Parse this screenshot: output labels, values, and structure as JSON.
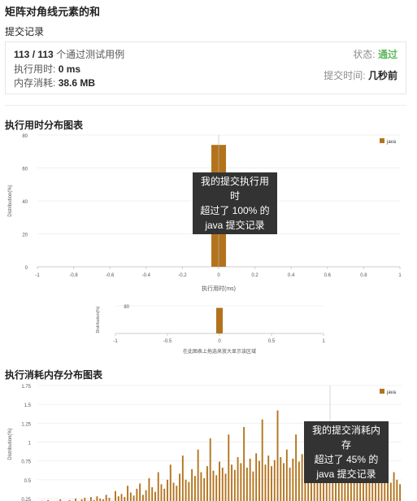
{
  "page": {
    "title": "矩阵对角线元素的和",
    "subtitle": "提交记录"
  },
  "summary": {
    "passed": "113 / 113",
    "passed_suffix": "个通过测试用例",
    "runtime_label": "执行用时:",
    "runtime_value": "0 ms",
    "memory_label": "内存消耗:",
    "memory_value": "38.6 MB",
    "status_label": "状态:",
    "status_value": "通过",
    "submit_time_label": "提交时间:",
    "submit_time_value": "几秒前"
  },
  "colors": {
    "accent_ok": "#5cb85c",
    "bar": "#b3731d",
    "tooltip_bg": "#333333"
  },
  "runtime_section": {
    "title": "执行用时分布图表",
    "tooltip": [
      "我的提交执行用时",
      "超过了 100% 的",
      "java 提交记录"
    ],
    "brush_hint": "在此图表上拖选来放大显示该区域"
  },
  "memory_section": {
    "title": "执行消耗内存分布图表",
    "tooltip": [
      "我的提交消耗内存",
      "超过了 45% 的",
      "java 提交记录"
    ]
  },
  "chart_data": [
    {
      "type": "bar",
      "title": "执行用时分布图表",
      "xlabel": "执行用时(ms)",
      "ylabel": "Distribution(%)",
      "xlim": [
        -1,
        1
      ],
      "ylim": [
        0,
        80
      ],
      "x_ticks": [
        "-1",
        "-0.8",
        "-0.6",
        "-0.4",
        "-0.2",
        "0",
        "0.2",
        "0.4",
        "0.6",
        "0.8",
        "1"
      ],
      "y_ticks": [
        "0",
        "20",
        "40",
        "60",
        "80"
      ],
      "legend": "java",
      "legend_position": "top-right",
      "series": [
        {
          "name": "java",
          "x": [
            0
          ],
          "values": [
            74
          ]
        }
      ]
    },
    {
      "type": "bar",
      "title": "",
      "xlabel": "在此图表上拖选来放大显示该区域",
      "ylabel": "Distribution(%)",
      "xlim": [
        -1,
        1
      ],
      "ylim": [
        0,
        80
      ],
      "x_ticks": [
        "-1",
        "-0.5",
        "0",
        "0.5",
        "1"
      ],
      "y_ticks": [
        "80"
      ],
      "series": [
        {
          "name": "java",
          "x": [
            0
          ],
          "values": [
            74
          ]
        }
      ]
    },
    {
      "type": "bar",
      "title": "执行消耗内存分布图表",
      "ylabel": "Distribution(%)",
      "ylim": [
        0,
        1.75
      ],
      "y_ticks": [
        "0.25",
        "0.5",
        "0.75",
        "1",
        "1.25",
        "1.5",
        "1.75"
      ],
      "legend": "java",
      "legend_position": "top-right",
      "series": [
        {
          "name": "java",
          "values": [
            0.21,
            0.22,
            0.2,
            0.23,
            0.21,
            0.19,
            0.22,
            0.24,
            0.2,
            0.21,
            0.23,
            0.22,
            0.25,
            0.21,
            0.24,
            0.26,
            0.22,
            0.27,
            0.23,
            0.28,
            0.25,
            0.24,
            0.3,
            0.26,
            0.22,
            0.35,
            0.28,
            0.31,
            0.27,
            0.42,
            0.33,
            0.29,
            0.38,
            0.45,
            0.3,
            0.36,
            0.52,
            0.4,
            0.34,
            0.6,
            0.44,
            0.38,
            0.5,
            0.7,
            0.46,
            0.42,
            0.58,
            0.82,
            0.5,
            0.47,
            0.64,
            0.55,
            0.9,
            0.6,
            0.52,
            0.68,
            1.05,
            0.62,
            0.56,
            0.74,
            0.66,
            0.58,
            1.1,
            0.7,
            0.63,
            0.8,
            0.72,
            1.2,
            0.66,
            0.78,
            0.61,
            0.85,
            0.75,
            1.3,
            0.7,
            0.82,
            0.68,
            0.76,
            1.42,
            0.8,
            0.72,
            0.9,
            0.66,
            0.78,
            1.1,
            0.74,
            0.84,
            0.7,
            0.95,
            0.62,
            0.8,
            1.15,
            0.72,
            0.86,
            0.68,
            0.76,
            0.6,
            0.7,
            1.0,
            0.66,
            0.74,
            0.58,
            0.65,
            0.55,
            0.7,
            0.6,
            0.52,
            0.62,
            0.9,
            0.56,
            0.64,
            0.5,
            0.58,
            0.48,
            0.54,
            0.46,
            0.6,
            0.5,
            0.44
          ]
        }
      ]
    }
  ]
}
